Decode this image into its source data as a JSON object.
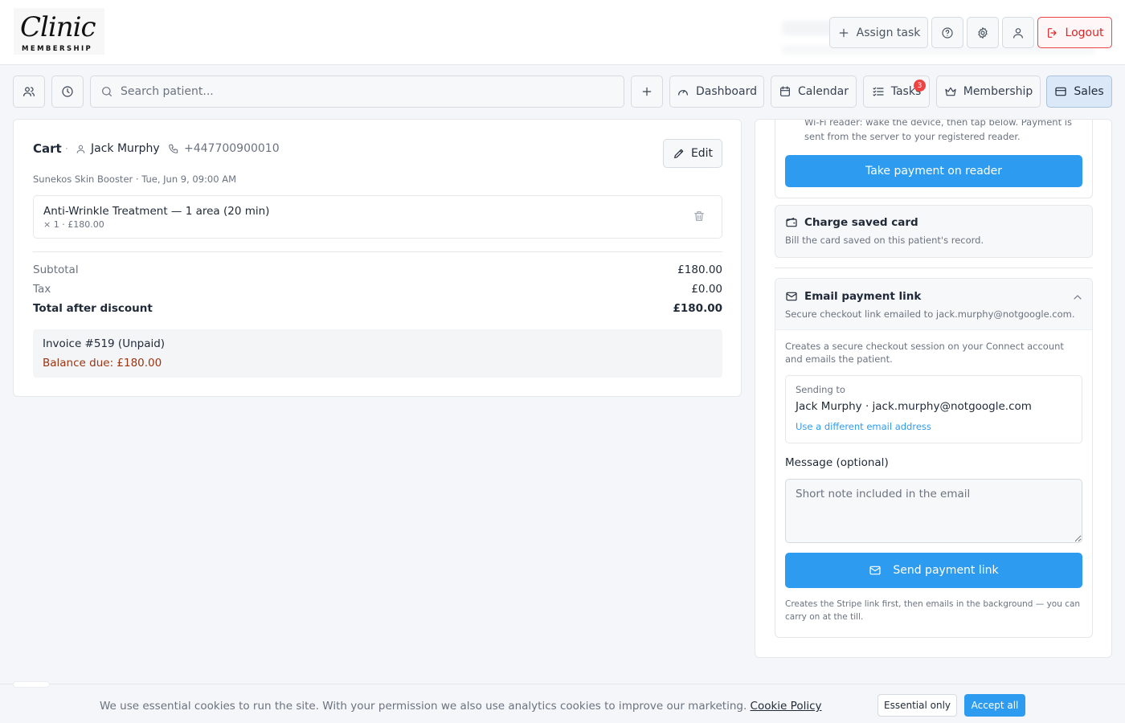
{
  "logo": {
    "script": "Clinic",
    "sub": "MEMBERSHIP"
  },
  "header": {
    "assign_task": "Assign task",
    "logout": "Logout"
  },
  "toolbar": {
    "search_placeholder": "Search patient...",
    "dashboard": "Dashboard",
    "calendar": "Calendar",
    "tasks": "Tasks",
    "tasks_badge": "3",
    "membership": "Membership",
    "sales": "Sales"
  },
  "cart": {
    "title": "Cart",
    "separator": "·",
    "patient_name": "Jack Murphy",
    "phone": "+447700900010",
    "edit": "Edit",
    "appointment": "Sunekos Skin Booster · Tue, Jun 9, 09:00 AM",
    "items": [
      {
        "name": "Anti-Wrinkle Treatment — 1 area (20 min)",
        "qty_price": "× 1 · £180.00"
      }
    ],
    "subtotal_label": "Subtotal",
    "subtotal_value": "£180.00",
    "tax_label": "Tax",
    "tax_value": "£0.00",
    "total_label": "Total after discount",
    "total_value": "£180.00",
    "invoice_title": "Invoice #519 (Unpaid)",
    "balance_due": "Balance due: £180.00"
  },
  "payment": {
    "reader_text": "Wi-Fi reader: wake the device, then tap below. Payment is sent from the server to your registered reader.",
    "take_payment": "Take payment on reader",
    "saved_card_title": "Charge saved card",
    "saved_card_desc": "Bill the card saved on this patient's record.",
    "email_title": "Email payment link",
    "email_sub": "Secure checkout link emailed to jack.murphy@notgoogle.com.",
    "email_desc": "Creates a secure checkout session on your Connect account and emails the patient.",
    "sending_label": "Sending to",
    "sending_to": "Jack Murphy · jack.murphy@notgoogle.com",
    "different_email": "Use a different email address",
    "message_label": "Message (optional)",
    "message_placeholder": "Short note included in the email",
    "send_button": "Send payment link",
    "send_note": "Creates the Stripe link first, then emails in the background — you can carry on at the till."
  },
  "cookie": {
    "text": "We use essential cookies to run the site. With your permission we also use analytics cookies to improve our marketing.",
    "policy_link": "Cookie Policy",
    "essential_only": "Essential only",
    "accept_all": "Accept all"
  },
  "colors": {
    "accent": "#2d9cf0",
    "danger": "#dc2626",
    "balance": "#9a3412",
    "active_tab_bg": "#dbe8f7"
  },
  "icons": {
    "assign": "plus-icon",
    "help": "help-circle-icon",
    "settings": "gear-icon",
    "user": "user-icon",
    "logout": "logout-icon",
    "patients": "users-icon",
    "history": "clock-icon",
    "search": "search-icon",
    "dashboard": "gauge-icon",
    "calendar": "calendar-icon",
    "tasks": "checklist-icon",
    "membership": "crown-icon",
    "sales": "credit-card-icon",
    "edit": "pencil-icon",
    "trash": "trash-icon",
    "wallet": "wallet-icon",
    "mail": "mail-icon",
    "chevron": "chevron-up-icon"
  }
}
